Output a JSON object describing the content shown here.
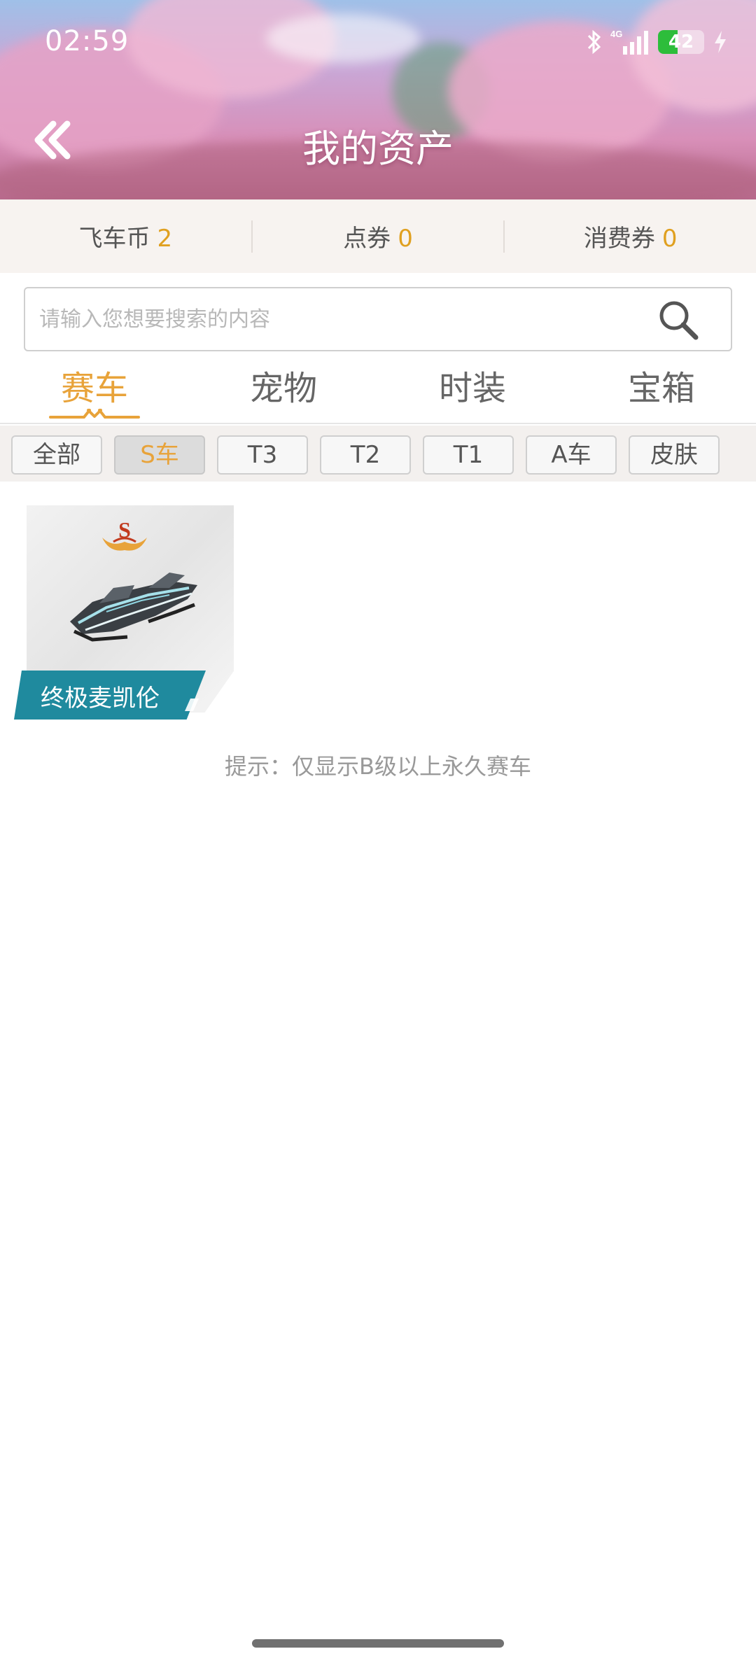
{
  "status_bar": {
    "time": "02:59",
    "network": "4G",
    "battery": "42",
    "battery_level": 0.42
  },
  "header": {
    "title": "我的资产",
    "back_icon": "double-chevron-left-icon"
  },
  "currencies": [
    {
      "label": "飞车币",
      "value": "2"
    },
    {
      "label": "点券",
      "value": "0"
    },
    {
      "label": "消费券",
      "value": "0"
    }
  ],
  "search": {
    "placeholder": "请输入您想要搜索的内容",
    "value": "",
    "icon": "search-icon"
  },
  "tabs": [
    {
      "label": "赛车",
      "active": true
    },
    {
      "label": "宠物",
      "active": false
    },
    {
      "label": "时装",
      "active": false
    },
    {
      "label": "宝箱",
      "active": false
    }
  ],
  "filters": [
    {
      "label": "全部",
      "active": false
    },
    {
      "label": "S车",
      "active": true
    },
    {
      "label": "T3",
      "active": false
    },
    {
      "label": "T2",
      "active": false
    },
    {
      "label": "T1",
      "active": false
    },
    {
      "label": "A车",
      "active": false
    },
    {
      "label": "皮肤",
      "active": false
    }
  ],
  "items": [
    {
      "name": "终极麦凯伦",
      "grade": "S"
    }
  ],
  "hint": "提示：仅显示B级以上永久赛车",
  "colors": {
    "accent": "#e8a33a",
    "currency_value": "#e0a020",
    "name_plate": "#1f8a9e"
  }
}
